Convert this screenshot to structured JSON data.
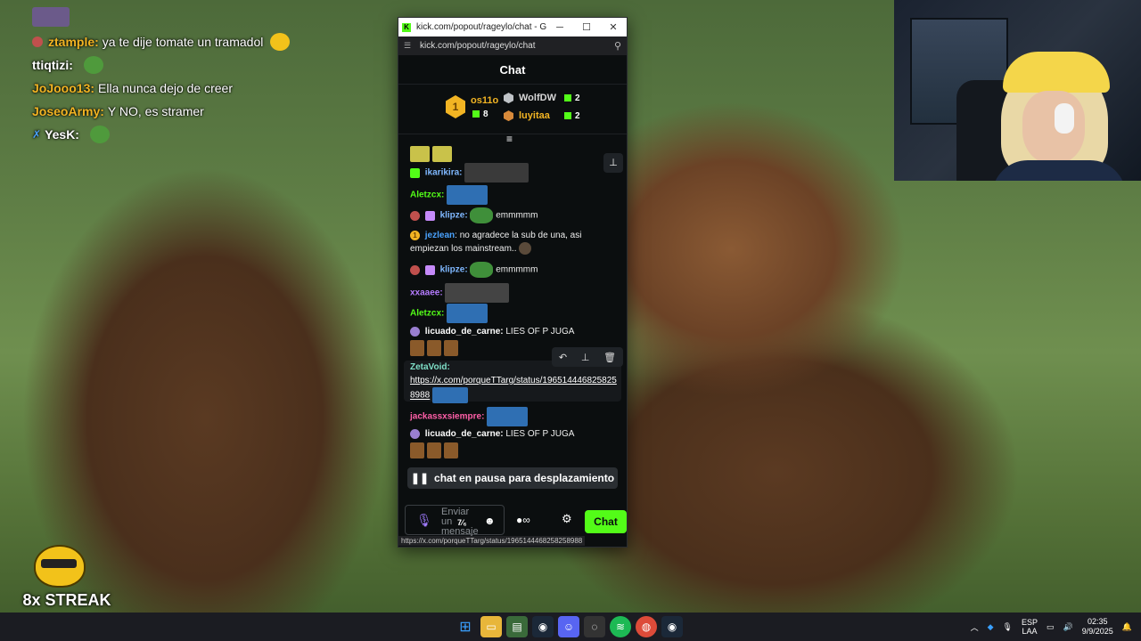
{
  "overlay_chat": {
    "lines": [
      {
        "user": "ztample:",
        "text": "ya te dije tomate un tramadol",
        "user_color": "#f2b423"
      },
      {
        "user": "ttiqtizi:",
        "text": "",
        "user_color": "#ffffff"
      },
      {
        "user": "JoJooo13:",
        "text": "Ella nunca dejo de creer",
        "user_color": "#f2b423"
      },
      {
        "user": "JoseoArmy:",
        "text": "Y NO, es stramer",
        "user_color": "#f2b423"
      },
      {
        "user": "YesK:",
        "text": "",
        "user_color": "#ffffff"
      }
    ],
    "streak": "8x STREAK"
  },
  "window": {
    "title": "kick.com/popout/rageylo/chat - Google...",
    "favicon": "K",
    "minimize": "─",
    "maximize": "☐",
    "close": "✕",
    "url": "kick.com/popout/rageylo/chat"
  },
  "chat": {
    "header": "Chat",
    "leaderboard": {
      "rank_badge": "1",
      "top_user": "os11o",
      "top_count": "8",
      "users": [
        {
          "name": "WolfDW",
          "count": "2"
        },
        {
          "name": "luyitaa",
          "count": "2"
        }
      ]
    },
    "messages": {
      "m1_user": "ikarikira:",
      "m2_user": "Aletzcx:",
      "m3_user": "klipze:",
      "m3_text": "emmmmm",
      "m4_badge": "1",
      "m4_user": "jezlean",
      "m4_text": ": no agradece la sub de una, asi empiezan los mainstream..",
      "m5_user": "klipze:",
      "m5_text": "emmmmm",
      "m6_user": "xxaaee:",
      "m7_user": "Aletzcx:",
      "m8_user": "licuado_de_carne:",
      "m8_text": "LIES OF P JUGA",
      "m9_user": "ZetaVoid:",
      "m9_link": "https://x.com/porqueTTarg/status/1965144468258258988",
      "m10_user": "jackassxsiempre:",
      "m11_user": "licuado_de_carne:",
      "m11_text": "LIES OF P JUGA"
    },
    "paused_text": "chat en pausa para desplazamiento",
    "input_placeholder": "Enviar un mensaje",
    "send_label": "Chat",
    "status_url": "https://x.com/porqueTTarg/status/1965144468258258988"
  },
  "taskbar": {
    "lang_top": "ESP",
    "lang_bottom": "LAA",
    "time": "02:35",
    "date": "9/9/2025"
  }
}
